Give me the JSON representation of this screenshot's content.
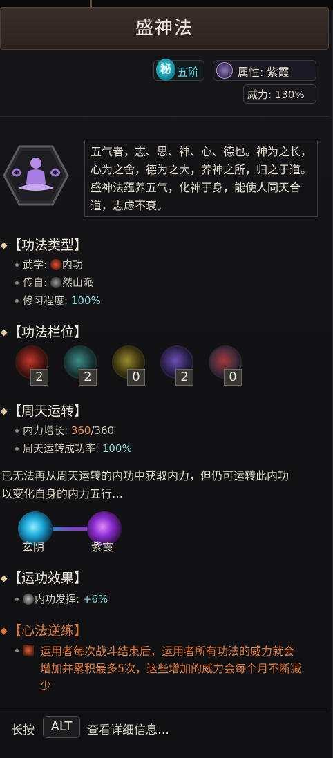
{
  "title": "盛神法",
  "tier": {
    "icon_char": "秘",
    "label": "五阶",
    "color": "#3fd3e6"
  },
  "attribute": {
    "label": "属性: 紫霞",
    "icon": "purple-mist-icon"
  },
  "power": {
    "label": "威力: 130%"
  },
  "description": "五气者，志、思、神、心、德也。神为之长，心为之舍，德为之大，养神之所，归之于道。盛神法蕴养五气，化神于身，能使人同天合道，志虑不衰。",
  "sections": {
    "type": {
      "header": "【功法类型】",
      "martial_label": "武学: ",
      "martial_value": "内功",
      "origin_label": "传自: ",
      "origin_value": "然山派",
      "progress_label": "修习程度: ",
      "progress_value": "100%"
    },
    "slots": {
      "header": "【功法栏位】",
      "items": [
        {
          "count": "2",
          "color": "#c0392b",
          "icon": "red-slot-icon"
        },
        {
          "count": "2",
          "color": "#3d8c86",
          "icon": "teal-slot-icon"
        },
        {
          "count": "0",
          "color": "#9a8a2e",
          "icon": "gold-slot-icon"
        },
        {
          "count": "2",
          "color": "#6b4fb5",
          "icon": "purple-slot-icon"
        },
        {
          "count": "0",
          "color": "#a23a3a",
          "icon": "mixed-slot-icon"
        }
      ]
    },
    "circulation": {
      "header": "【周天运转】",
      "growth_label": "内力增长: ",
      "growth_current": "360",
      "growth_max": "/360",
      "success_label": "周天运转成功率: ",
      "success_value": "100%"
    },
    "notice": "已无法再从周天运转的内功中获取内力，但仍可运转此内功以变化自身的内力五行…",
    "elements": {
      "from": "玄阴",
      "to": "紫霞"
    },
    "effects": {
      "header": "【运功效果】",
      "label": "内功发挥: ",
      "value": "+6%"
    },
    "reverse": {
      "header": "【心法逆练】",
      "text": "运用者每次战斗结束后，运用者所有功法的威力就会增加并累积最多5次，这些增加的威力会每个月不断减少"
    }
  },
  "footer": {
    "prefix": "长按",
    "key": "ALT",
    "suffix": "查看详细信息…"
  }
}
